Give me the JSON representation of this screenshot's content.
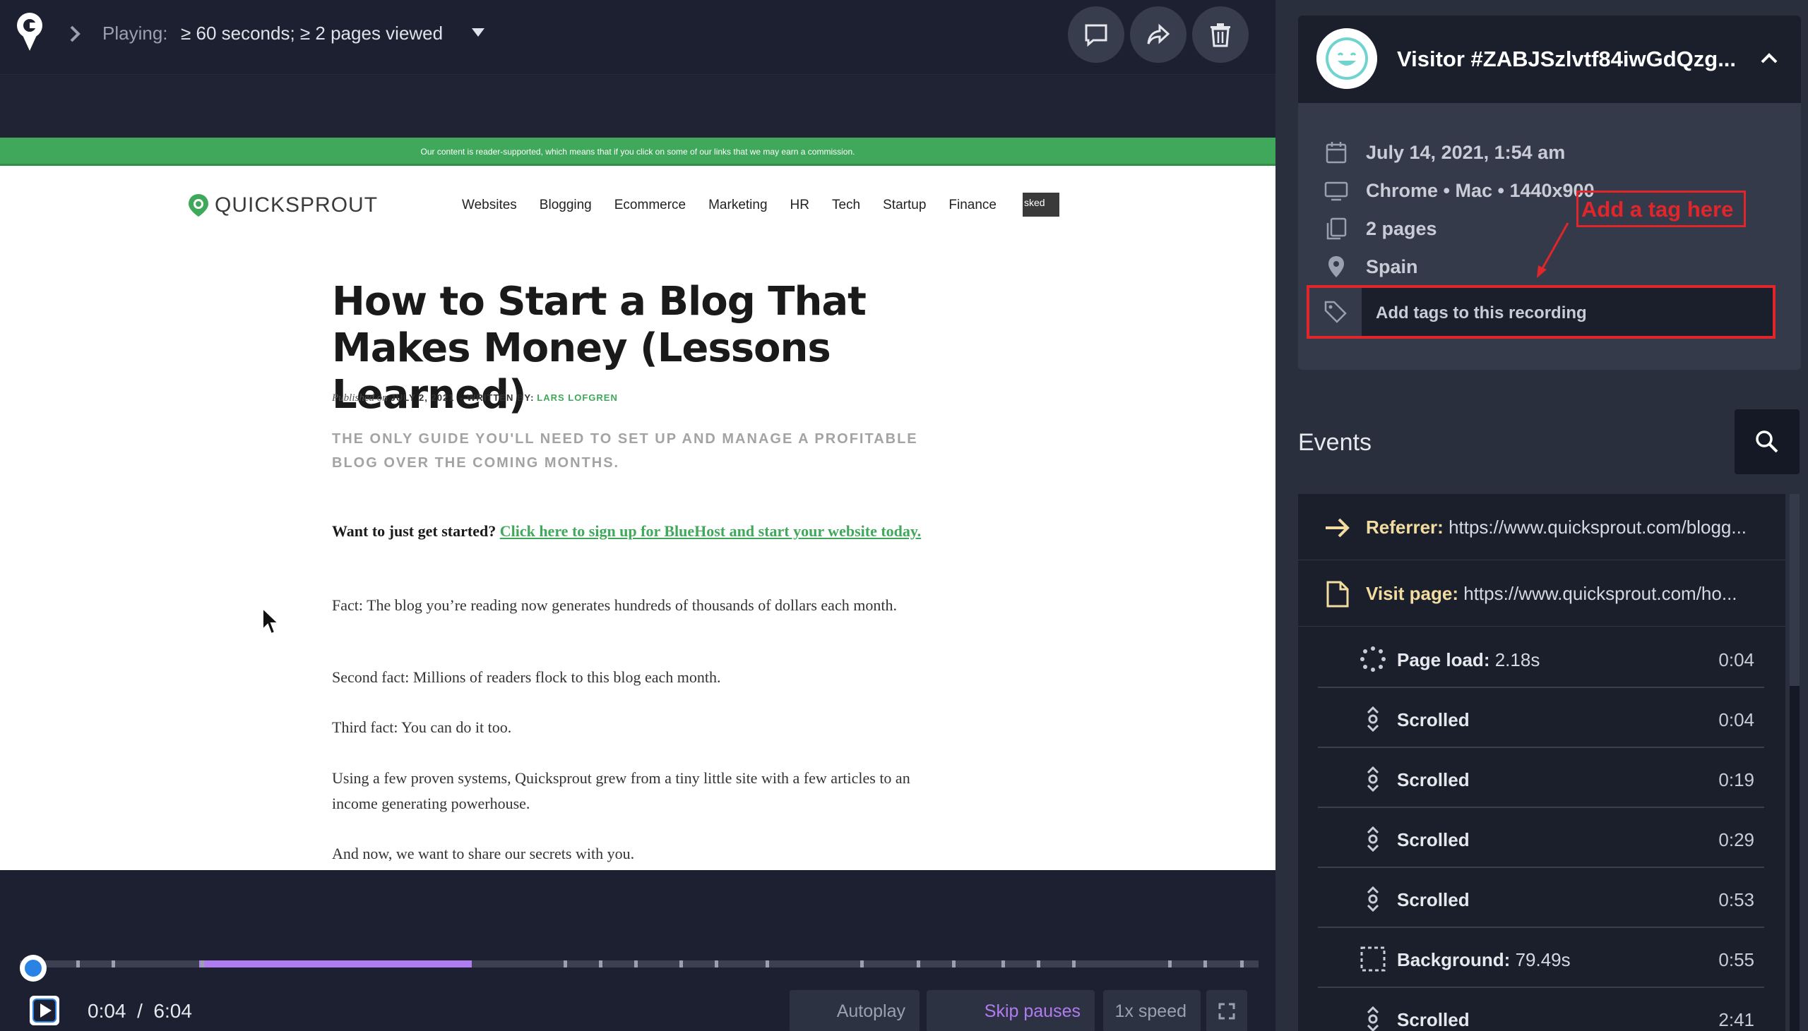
{
  "player": {
    "playing_label": "Playing:",
    "playing_value": "≥ 60 seconds; ≥ 2 pages viewed",
    "current_time": "0:04",
    "separator": "/",
    "total_time": "6:04",
    "progress_fraction": 0.011,
    "buttons": {
      "autoplay": "Autoplay",
      "skip_pauses": "Skip pauses",
      "speed": "1x speed"
    }
  },
  "site": {
    "banner": "Our content is reader-supported, which means that if you click on some of our links that we may earn a commission.",
    "logo_text": "QUICKSPROUT",
    "nav": [
      "Websites",
      "Blogging",
      "Ecommerce",
      "Marketing",
      "HR",
      "Tech",
      "Startup",
      "Finance"
    ],
    "masked_label": "sked",
    "title": "How to Start a Blog That Makes Money (Lessons Learned)",
    "meta_published": "Published on",
    "meta_date": "JULY 2, 2021",
    "meta_written": "- WRITTEN BY:",
    "meta_author": "LARS LOFGREN",
    "subtitle": "THE ONLY GUIDE YOU'LL NEED TO SET UP AND MANAGE A PROFITABLE BLOG OVER THE COMING MONTHS.",
    "intro_bold": "Want to just get started?",
    "intro_link": "Click here to sign up for BlueHost and start your website today.",
    "paragraphs": [
      "Fact: The blog you’re reading now generates hundreds of thousands of dollars each month.",
      "Second fact: Millions of readers flock to this blog each month.",
      "Third fact: You can do it too.",
      "Using a few proven systems, Quicksprout grew from a tiny little site with a few articles to an income generating powerhouse.",
      "And now, we want to share our secrets with you."
    ]
  },
  "visitor": {
    "title": "Visitor #ZABJSzlvtf84iwGdQzg...",
    "date": "July 14, 2021, 1:54 am",
    "device": "Chrome • Mac • 1440x900",
    "pages": "2 pages",
    "location": "Spain",
    "tag_placeholder": "Add tags to this recording",
    "annotation": "Add a tag here"
  },
  "events": {
    "title": "Events",
    "referrer_label": "Referrer:",
    "referrer_url": "https://www.quicksprout.com/blogg...",
    "visit_label": "Visit page:",
    "visit_url": "https://www.quicksprout.com/ho...",
    "items": [
      {
        "label": "Page load:",
        "detail": "2.18s",
        "time": "0:04"
      },
      {
        "label": "Scrolled",
        "detail": "",
        "time": "0:04"
      },
      {
        "label": "Scrolled",
        "detail": "",
        "time": "0:19"
      },
      {
        "label": "Scrolled",
        "detail": "",
        "time": "0:29"
      },
      {
        "label": "Scrolled",
        "detail": "",
        "time": "0:53"
      },
      {
        "label": "Background:",
        "detail": "79.49s",
        "time": "0:55"
      },
      {
        "label": "Scrolled",
        "detail": "",
        "time": "2:41"
      }
    ]
  },
  "colors": {
    "accent_purple": "#b07cf0",
    "scrubber_blue": "#2a82e4",
    "brand_green": "#3fa85a",
    "annotation_red": "#e0262a",
    "event_label_yellow": "#f2dca0"
  }
}
